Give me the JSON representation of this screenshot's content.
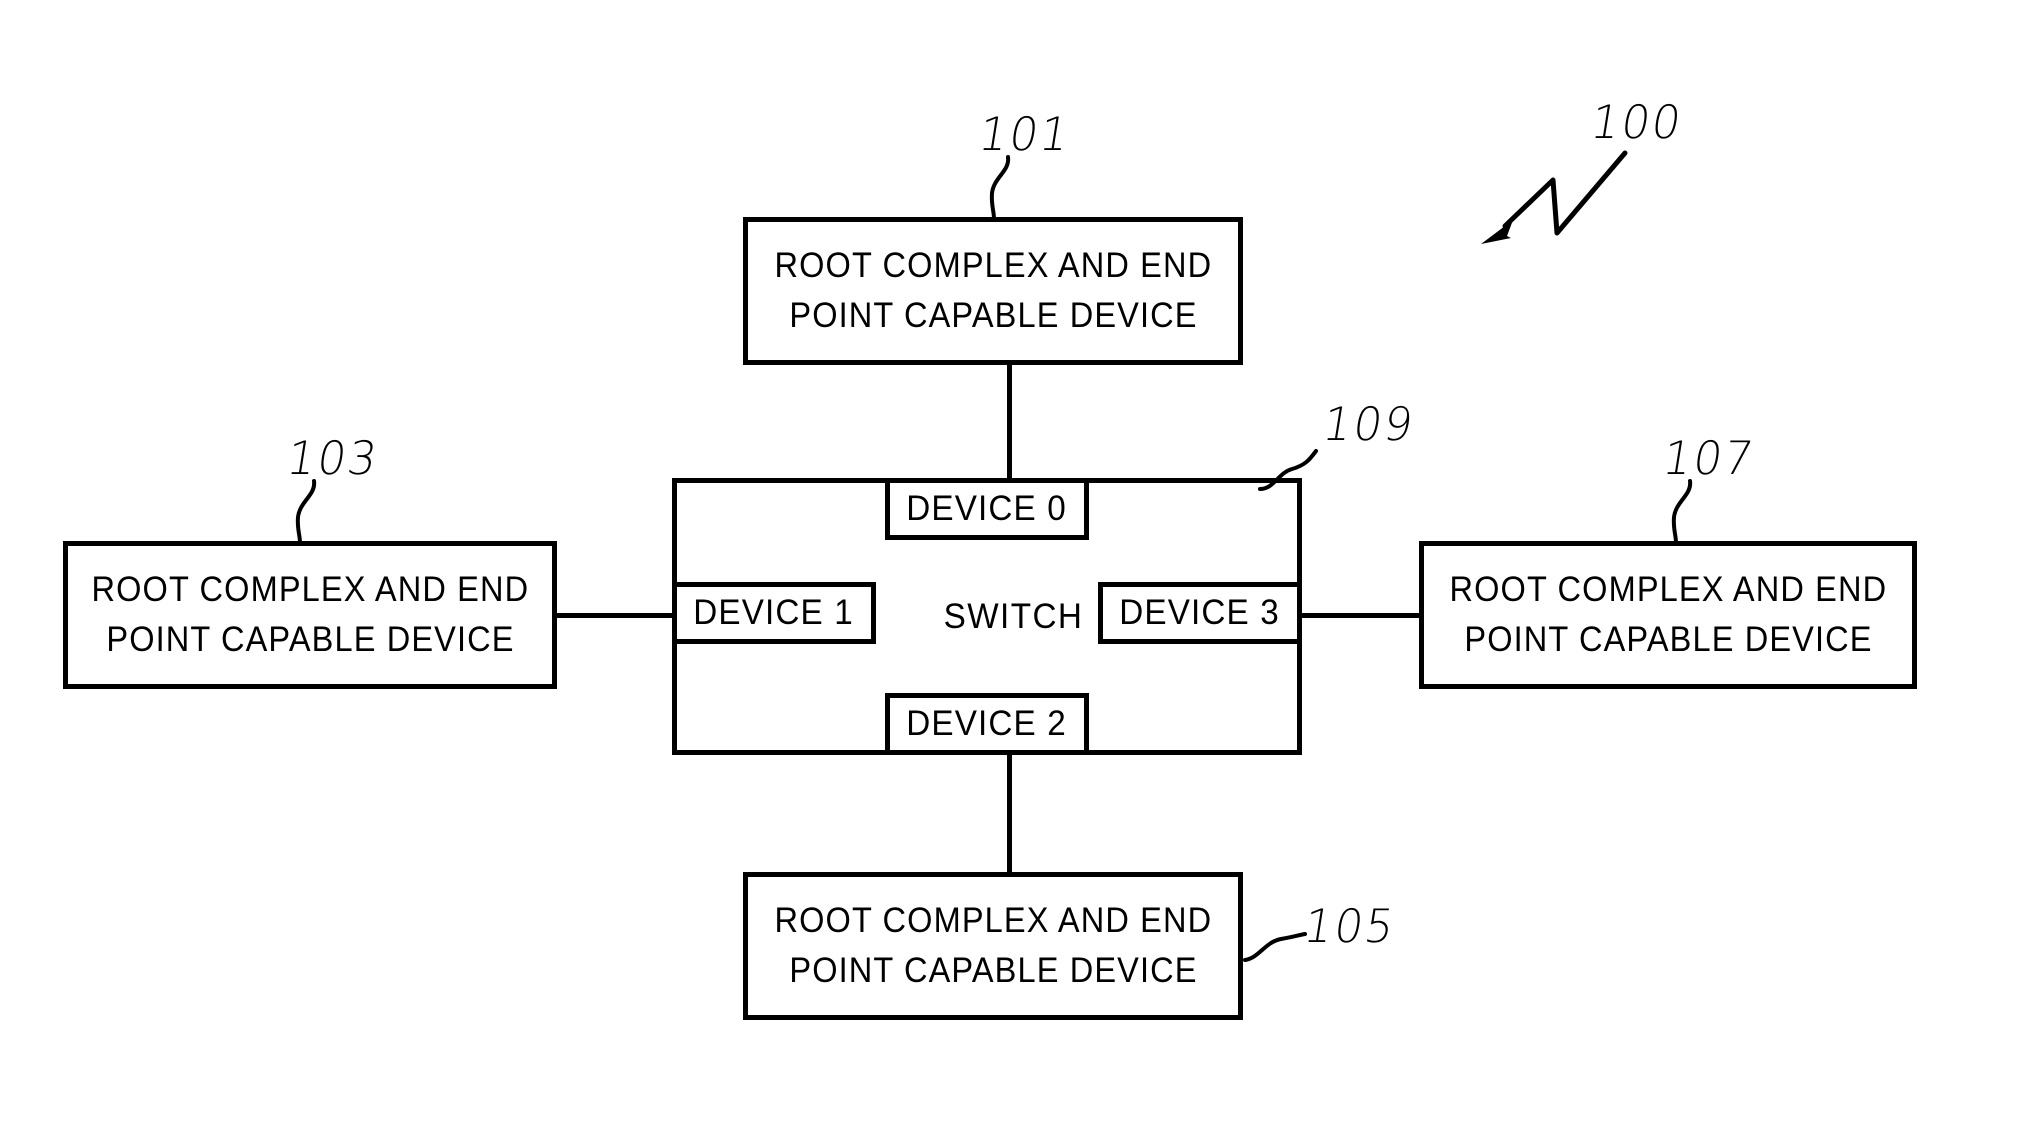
{
  "figure": {
    "reference_numeral": "100",
    "arrow_icon": "zigzag-arrow-icon"
  },
  "switch": {
    "label": "SWITCH",
    "reference_numeral": "109",
    "ports": [
      {
        "id": "device-0",
        "label": "DEVICE 0",
        "edge": "top"
      },
      {
        "id": "device-1",
        "label": "DEVICE 1",
        "edge": "left"
      },
      {
        "id": "device-2",
        "label": "DEVICE 2",
        "edge": "bottom"
      },
      {
        "id": "device-3",
        "label": "DEVICE 3",
        "edge": "right"
      }
    ]
  },
  "nodes": [
    {
      "id": "node-top",
      "line1": "ROOT COMPLEX AND END",
      "line2": "POINT CAPABLE DEVICE",
      "reference_numeral": "101",
      "connects_to": "DEVICE 0"
    },
    {
      "id": "node-left",
      "line1": "ROOT COMPLEX AND END",
      "line2": "POINT CAPABLE DEVICE",
      "reference_numeral": "103",
      "connects_to": "DEVICE 1"
    },
    {
      "id": "node-bottom",
      "line1": "ROOT COMPLEX AND END",
      "line2": "POINT CAPABLE DEVICE",
      "reference_numeral": "105",
      "connects_to": "DEVICE 2"
    },
    {
      "id": "node-right",
      "line1": "ROOT COMPLEX AND END",
      "line2": "POINT CAPABLE DEVICE",
      "reference_numeral": "107",
      "connects_to": "DEVICE 3"
    }
  ],
  "colors": {
    "ink": "#000000",
    "paper": "#ffffff"
  }
}
